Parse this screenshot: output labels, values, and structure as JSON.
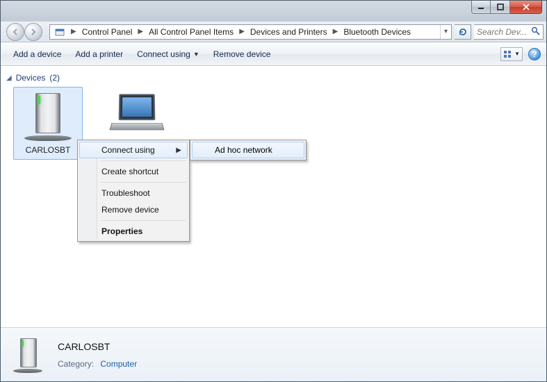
{
  "breadcrumbs": {
    "items": [
      "Control Panel",
      "All Control Panel Items",
      "Devices and Printers",
      "Bluetooth Devices"
    ]
  },
  "search": {
    "placeholder": "Search Dev..."
  },
  "commands": {
    "add_device": "Add a device",
    "add_printer": "Add a printer",
    "connect_using": "Connect using",
    "remove_device": "Remove device"
  },
  "group": {
    "label": "Devices",
    "count": "(2)"
  },
  "devices": [
    {
      "name": "CARLOSBT"
    },
    {
      "name": ""
    }
  ],
  "context_menu": {
    "connect_using": "Connect using",
    "create_shortcut": "Create shortcut",
    "troubleshoot": "Troubleshoot",
    "remove_device": "Remove device",
    "properties": "Properties",
    "submenu": {
      "ad_hoc": "Ad hoc network"
    }
  },
  "details": {
    "name": "CARLOSBT",
    "category_label": "Category:",
    "category_value": "Computer"
  },
  "help_glyph": "?"
}
